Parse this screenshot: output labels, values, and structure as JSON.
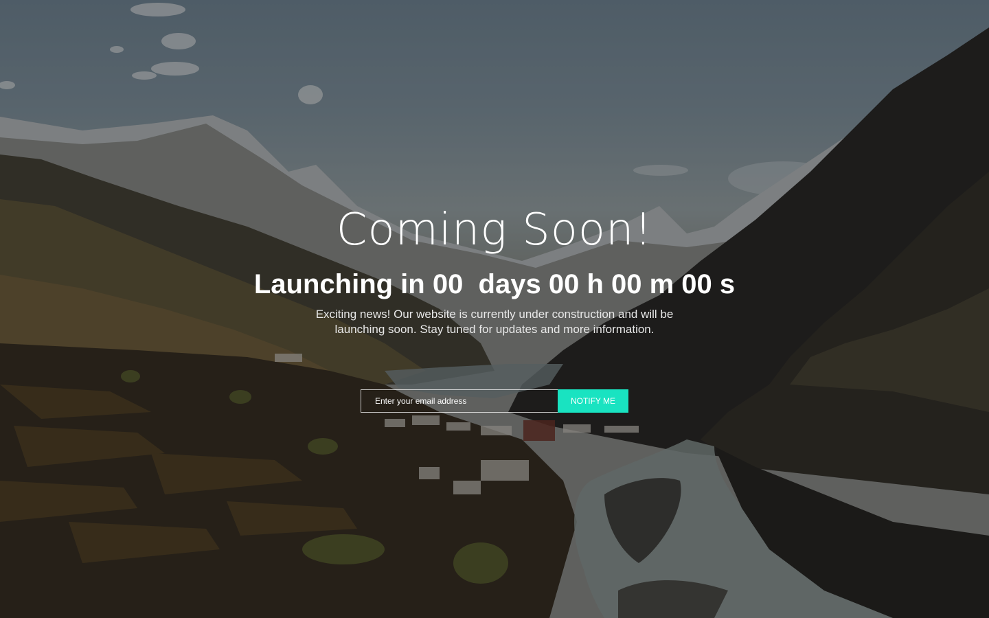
{
  "hero": {
    "title": "Coming Soon!",
    "countdown": "Launching in 00  days 00 h 00 m 00 s",
    "description": "Exciting news! Our website is currently under construction and will be launching soon. Stay tuned for updates and more information."
  },
  "subscribe": {
    "email_placeholder": "Enter your email address",
    "button_label": "NOTIFY ME"
  },
  "colors": {
    "accent": "#19e3c1",
    "text": "#ffffff"
  }
}
